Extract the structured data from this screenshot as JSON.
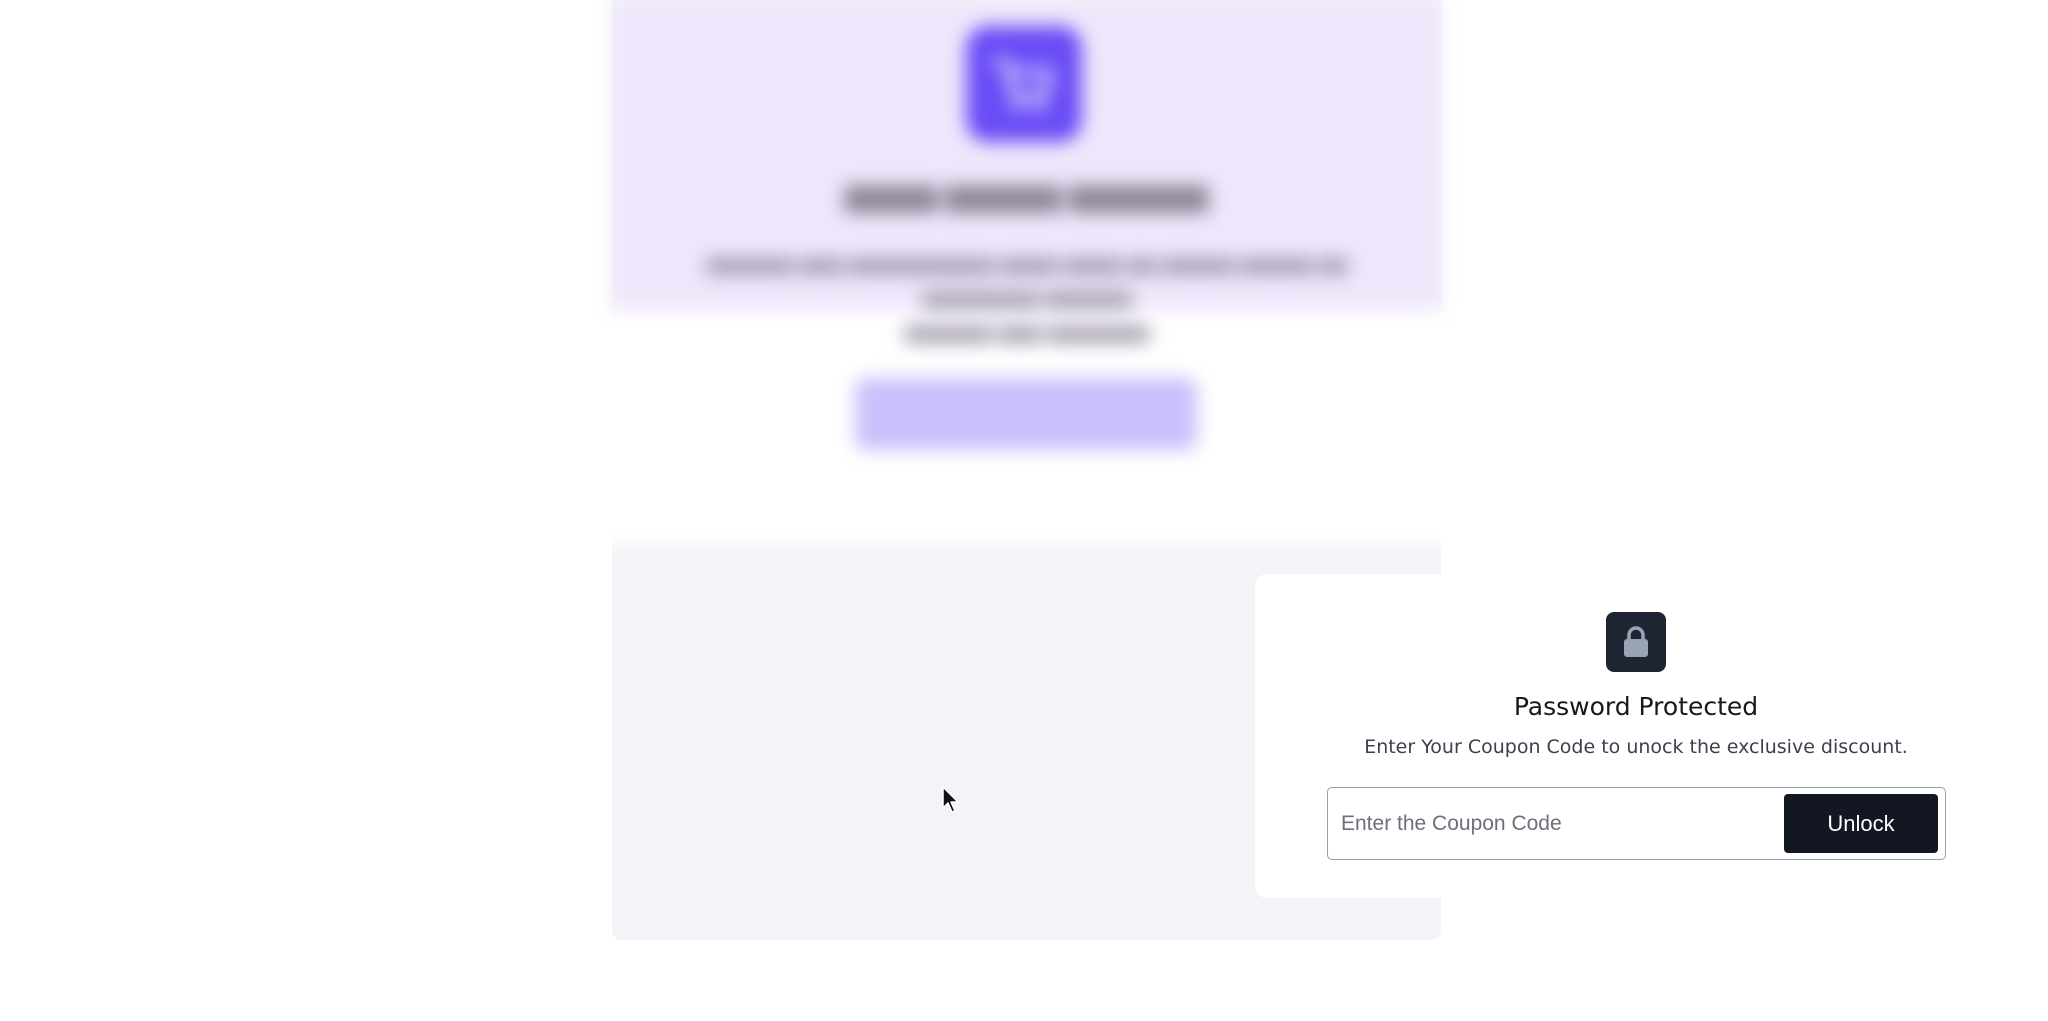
{
  "background": {
    "hero_color": "#efe6fb",
    "logo_color": "#6a4cf6",
    "logo_icon": "cart-icon",
    "cta_color": "#c9c1fb"
  },
  "lock": {
    "icon": "lock-icon",
    "badge_color": "#1f2533",
    "title": "Password Protected",
    "subtitle": "Enter Your Coupon Code to unock the exclusive discount.",
    "input_placeholder": "Enter the Coupon Code",
    "input_value": "",
    "button_label": "Unlock",
    "button_color": "#121722"
  }
}
